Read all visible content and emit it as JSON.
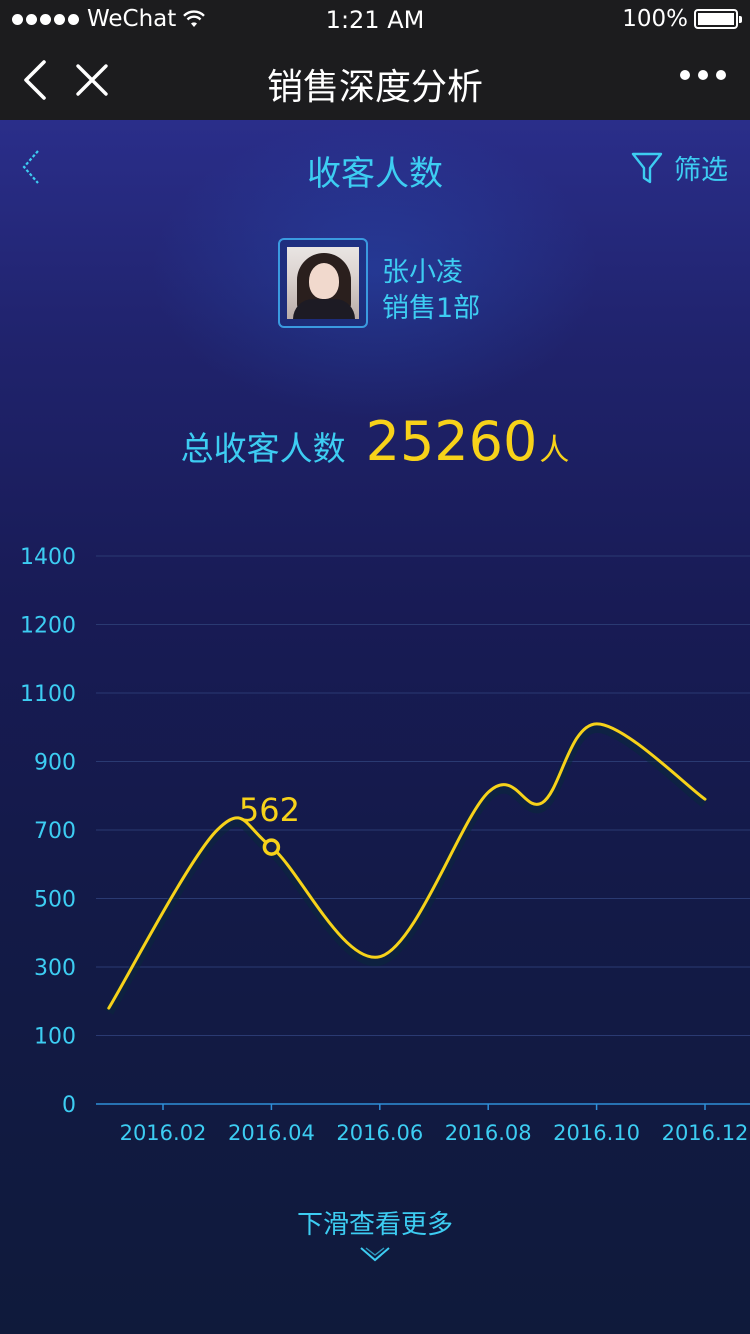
{
  "status_bar": {
    "carrier": "WeChat",
    "time": "1:21 AM",
    "battery": "100%"
  },
  "wechat_nav": {
    "title": "销售深度分析"
  },
  "page": {
    "title": "收客人数",
    "filter_label": "筛选"
  },
  "profile": {
    "name": "张小凌",
    "department": "销售1部"
  },
  "summary": {
    "label": "总收客人数",
    "value": "25260",
    "unit": "人"
  },
  "chart_data": {
    "type": "line",
    "y_tick_labels": [
      "0",
      "100",
      "300",
      "500",
      "700",
      "900",
      "1100",
      "1200",
      "1400"
    ],
    "x_tick_labels": [
      "2016.02",
      "2016.04",
      "2016.06",
      "2016.08",
      "2016.10",
      "2016.12"
    ],
    "series": [
      {
        "x": [
          "2016.01",
          "2016.03",
          "2016.04",
          "2016.06",
          "2016.08",
          "2016.09",
          "2016.10",
          "2016.12"
        ],
        "values": [
          180,
          700,
          650,
          330,
          810,
          780,
          1010,
          790
        ],
        "color": "#f7d21a"
      }
    ],
    "highlight": {
      "x": "2016.04",
      "label": "562"
    },
    "grid": true
  },
  "footer": {
    "scroll_hint": "下滑查看更多"
  },
  "colors": {
    "accent_cyan": "#3dcdf2",
    "accent_yellow": "#f7d21a",
    "gridline": "#2a3a72"
  }
}
